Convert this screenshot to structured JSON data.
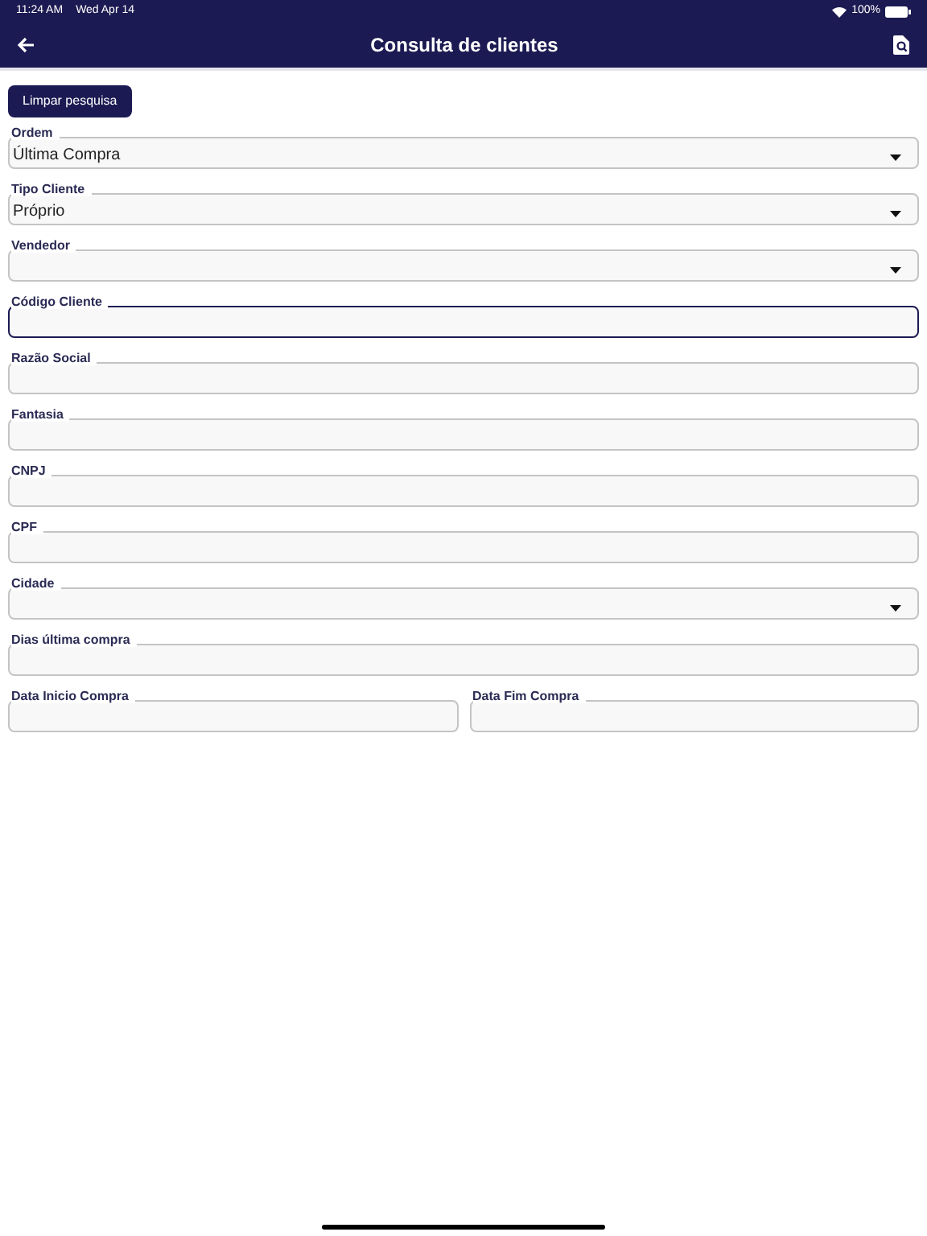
{
  "status_bar": {
    "time": "11:24 AM",
    "date": "Wed Apr 14",
    "battery": "100%"
  },
  "header": {
    "title": "Consulta de clientes"
  },
  "clear_button": "Limpar pesquisa",
  "rows": [
    [
      {
        "kind": "select",
        "label": "Ordem",
        "value": "Última Compra",
        "focused": false
      }
    ],
    [
      {
        "kind": "select",
        "label": "Tipo Cliente",
        "value": "Próprio",
        "focused": false
      }
    ],
    [
      {
        "kind": "select",
        "label": "Vendedor",
        "focused": false
      }
    ],
    [
      {
        "kind": "text",
        "label": "Código Cliente",
        "focused": true
      }
    ],
    [
      {
        "kind": "text",
        "label": "Razão Social",
        "focused": false
      }
    ],
    [
      {
        "kind": "text",
        "label": "Fantasia",
        "focused": false
      }
    ],
    [
      {
        "kind": "text",
        "label": "CNPJ",
        "focused": false
      }
    ],
    [
      {
        "kind": "text",
        "label": "CPF",
        "focused": false
      }
    ],
    [
      {
        "kind": "select",
        "label": "Cidade",
        "focused": false
      }
    ],
    [
      {
        "kind": "text",
        "label": "Dias última compra",
        "focused": false
      }
    ],
    [
      {
        "kind": "text",
        "label": "Data Inicio Compra",
        "focused": false
      },
      {
        "kind": "text",
        "label": "Data Fim Compra",
        "focused": false
      }
    ]
  ]
}
